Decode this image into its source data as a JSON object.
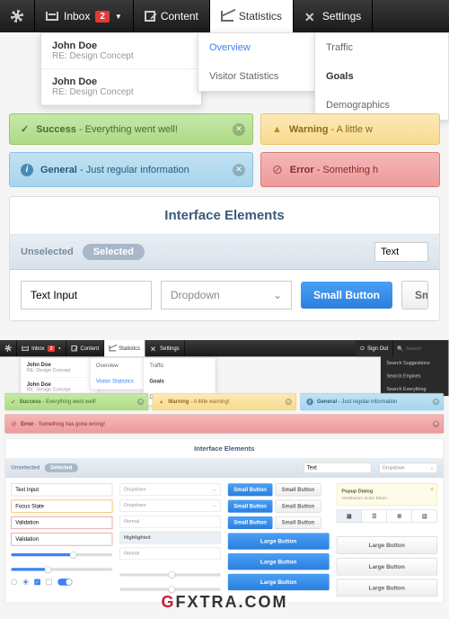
{
  "nav": {
    "inbox": "Inbox",
    "inbox_badge": "2",
    "content": "Content",
    "statistics": "Statistics",
    "settings": "Settings",
    "signout": "Sign Out",
    "search_placeholder": "Search"
  },
  "inbox_dd": [
    {
      "name": "John Doe",
      "sub": "RE: Design Concept"
    },
    {
      "name": "John Doe",
      "sub": "RE: Design Concept"
    }
  ],
  "stats_dd": {
    "overview": "Overview",
    "visitor": "Visitor Statistics"
  },
  "stats_sub": {
    "traffic": "Traffic",
    "goals": "Goals",
    "demographics": "Demographics"
  },
  "search_dd": {
    "suggestions": "Search Suggestions",
    "engines": "Search Engines",
    "everything": "Search Everything"
  },
  "alerts": {
    "success_label": "Success",
    "success_text": " - Everything went well!",
    "warning_label": "Warning",
    "warning_text": " - A little w",
    "warning_text_full": " - A little warning!",
    "info_label": "General",
    "info_text": " - Just regular information",
    "error_label": "Error",
    "error_text": " - Something h",
    "error_text_full": " - Something has gone wrong!"
  },
  "panel": {
    "title": "Interface Elements",
    "tab_unselected": "Unselected",
    "tab_selected": "Selected",
    "text_short": "Text",
    "text_input": "Text Input",
    "dropdown": "Dropdown",
    "small_button": "Small Button",
    "small_btn_cut": "Sma",
    "focus_state": "Focus State",
    "validation": "Validation",
    "normal": "Normal",
    "highlighted": "Highlighted",
    "large_button": "Large Button",
    "popup_title": "Popup Dialog",
    "popup_sub": "Vestibulum Dolor Etiam"
  },
  "watermark": {
    "g": "G",
    "rest": "FXTRA.COM"
  }
}
